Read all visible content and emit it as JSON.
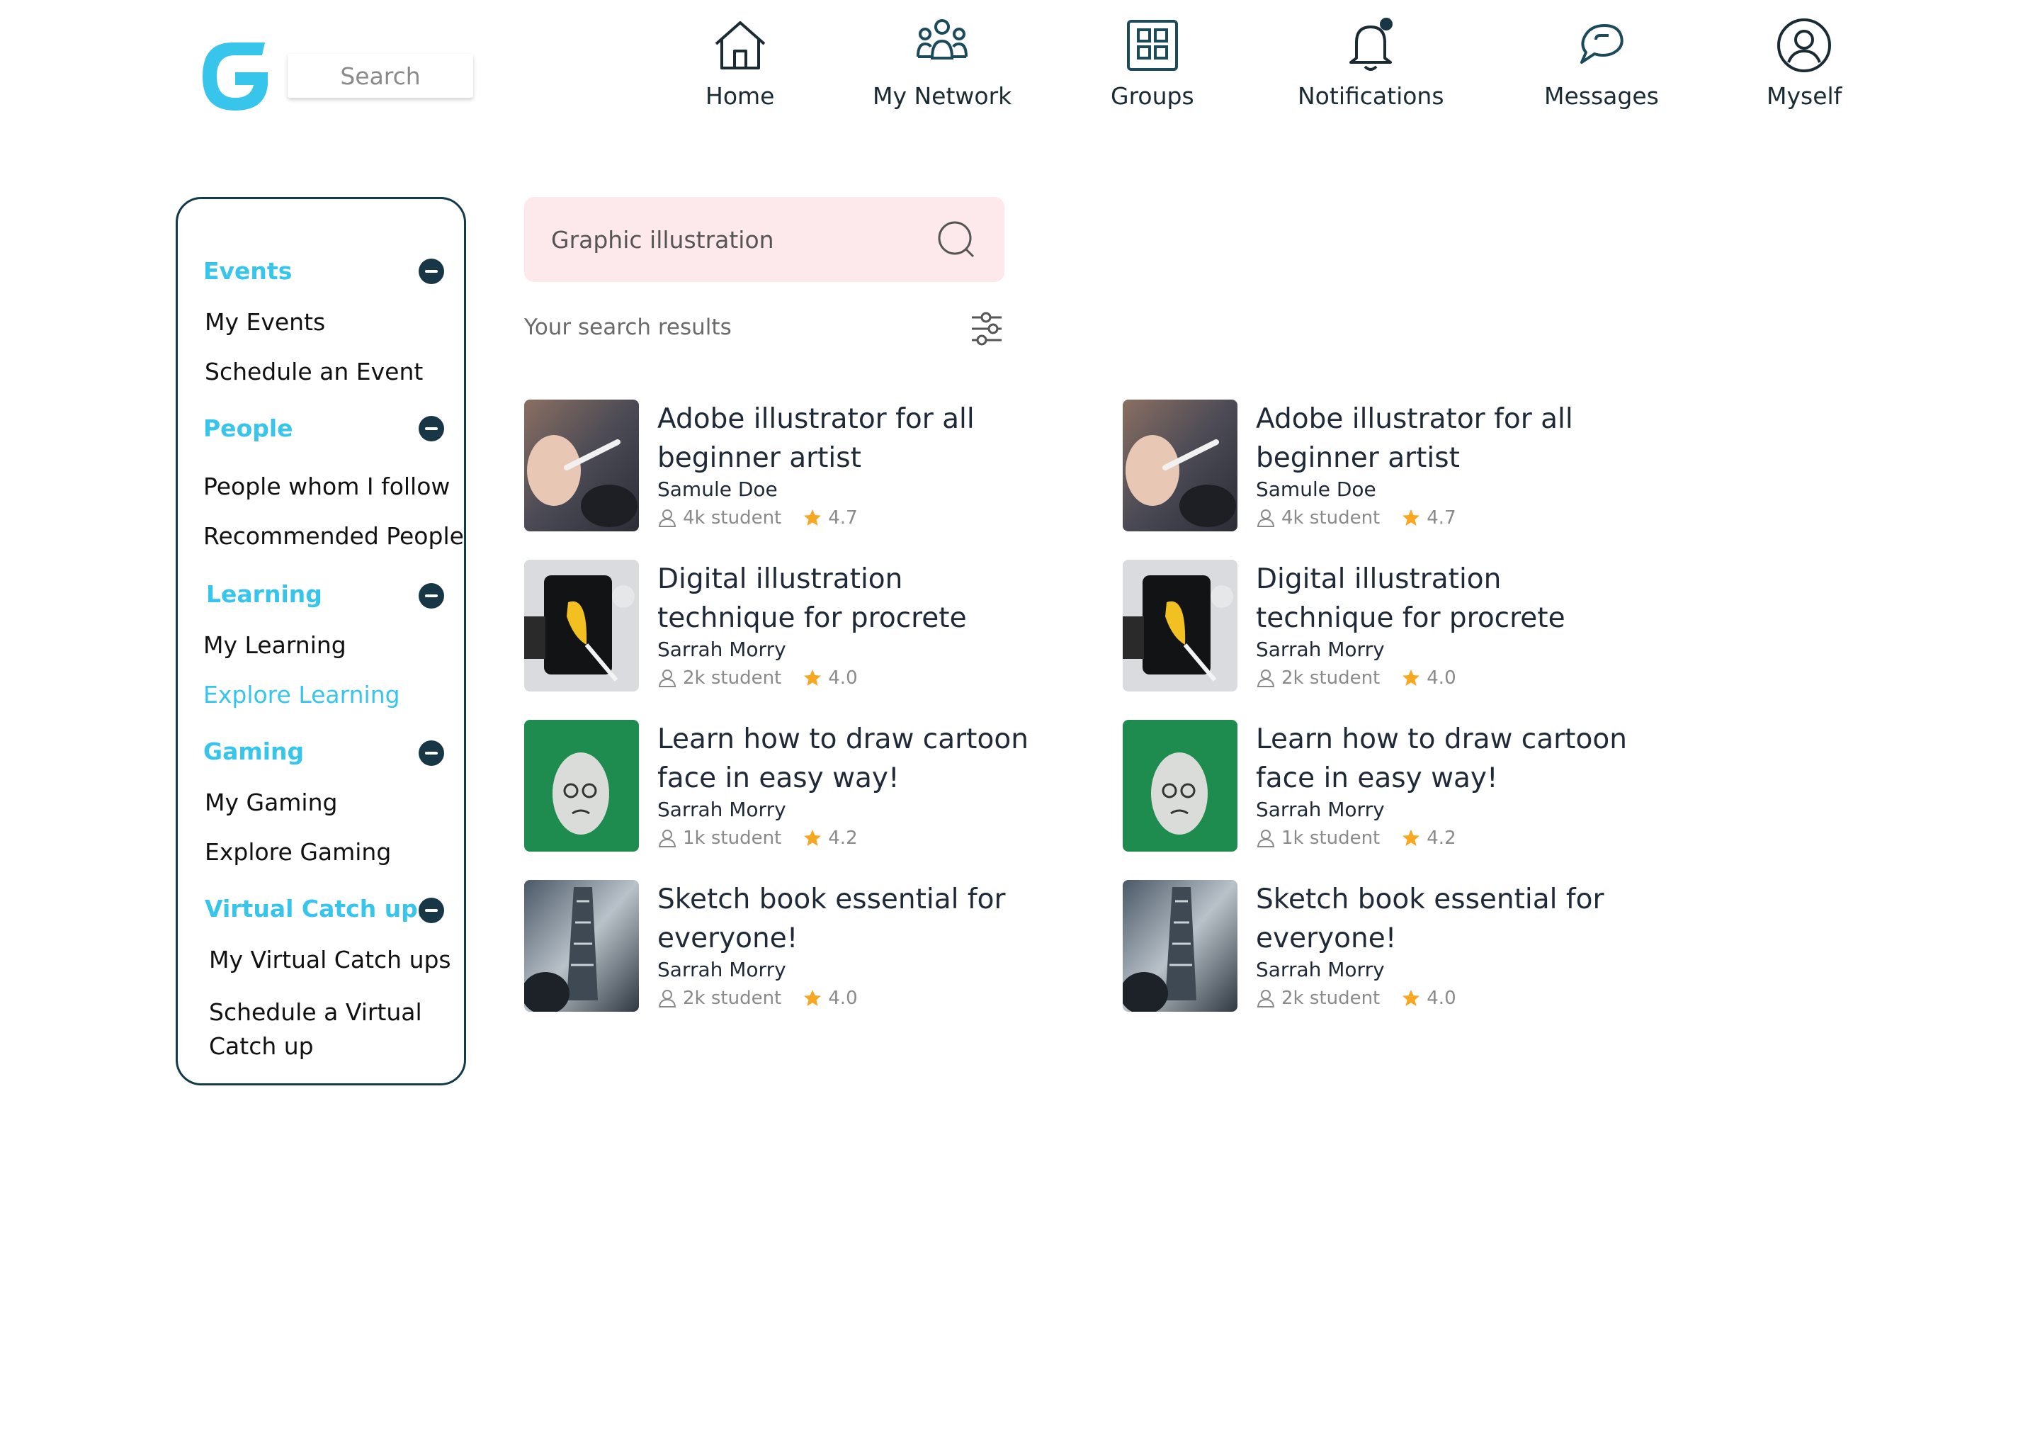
{
  "header": {
    "search_placeholder": "Search",
    "nav": [
      {
        "label": "Home",
        "icon": "home-icon"
      },
      {
        "label": "My Network",
        "icon": "network-icon"
      },
      {
        "label": "Groups",
        "icon": "groups-icon"
      },
      {
        "label": "Notifications",
        "icon": "bell-icon"
      },
      {
        "label": "Messages",
        "icon": "messages-icon"
      },
      {
        "label": "Myself",
        "icon": "user-circle-icon"
      }
    ]
  },
  "sidebar": {
    "sections": [
      {
        "title": "Events",
        "items": [
          "My Events",
          "Schedule an Event"
        ]
      },
      {
        "title": "People",
        "items": [
          "People whom I follow",
          "Recommended People"
        ]
      },
      {
        "title": "Learning",
        "items": [
          "My Learning",
          "Explore Learning"
        ]
      },
      {
        "title": "Gaming",
        "items": [
          "My Gaming",
          "Explore Gaming"
        ]
      },
      {
        "title": "Virtual Catch ups",
        "items": [
          "My Virtual Catch ups",
          "Schedule a Virtual Catch up"
        ]
      }
    ],
    "active_item": "Explore Learning"
  },
  "main": {
    "search_value": "Graphic illustration",
    "results_label": "Your search results",
    "courses": [
      {
        "title": "Adobe illustrator for all beginner artist",
        "author": "Samule Doe",
        "students": "4k student",
        "rating": "4.7"
      },
      {
        "title": "Digital illustration technique for procrete",
        "author": "Sarrah Morry",
        "students": "2k student",
        "rating": "4.0"
      },
      {
        "title": "Learn how to draw cartoon face in easy way!",
        "author": "Sarrah Morry",
        "students": "1k student",
        "rating": "4.2"
      },
      {
        "title": "Sketch book essential for everyone!",
        "author": "Sarrah Morry",
        "students": "2k student",
        "rating": "4.0"
      }
    ]
  },
  "colors": {
    "accent": "#38c5ec",
    "dark": "#123a48",
    "search_bg": "#fde9ec",
    "star": "#f7a823"
  }
}
